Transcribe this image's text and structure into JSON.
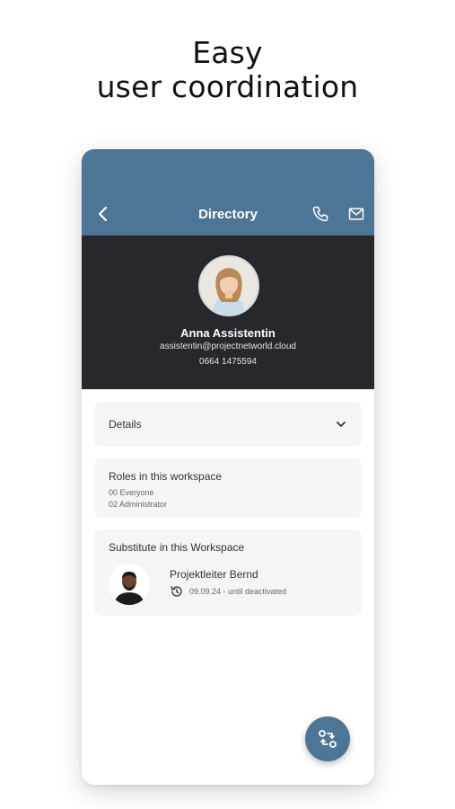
{
  "headline": {
    "line1": "Easy",
    "line2": "user coordination"
  },
  "appbar": {
    "title": "Directory"
  },
  "profile": {
    "name": "Anna Assistentin",
    "email": "assistentin@projectnetworld.cloud",
    "phone": "0664 1475594"
  },
  "details": {
    "label": "Details"
  },
  "roles": {
    "heading": "Roles in this workspace",
    "items": [
      "00 Everyone",
      "02 Administrator"
    ]
  },
  "substitute": {
    "heading": "Substitute in this Workspace",
    "name": "Projektleiter Bernd",
    "since": "09.09.24 - until deactivated"
  },
  "icons": {
    "back": "back-arrow-icon",
    "phone": "phone-icon",
    "mail": "mail-icon",
    "chevron": "chevron-down-icon",
    "history": "history-icon",
    "fab": "swap-icon"
  },
  "colors": {
    "appbar": "#4d7596",
    "profile_bg": "#27282b",
    "card_bg": "#f3f5f7",
    "fab": "#4d7596"
  }
}
